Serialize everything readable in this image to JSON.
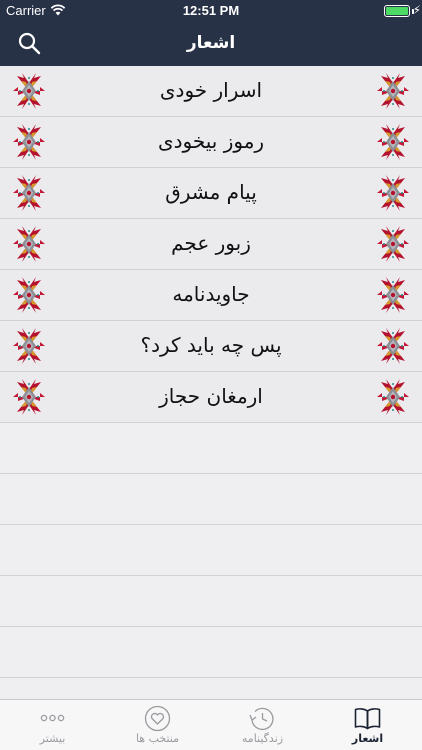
{
  "status_bar": {
    "carrier": "Carrier",
    "time": "12:51 PM",
    "battery_percent": 100
  },
  "header": {
    "title": "اشعار",
    "search_icon": "search-icon"
  },
  "colors": {
    "header_bg": "#283246",
    "row_bg": "#ebebee",
    "ornament_red": "#b5122f",
    "ornament_gold": "#d69a2c"
  },
  "poems": [
    {
      "label": "اسرار خودی"
    },
    {
      "label": "رموز بیخودی"
    },
    {
      "label": "پیام مشرق"
    },
    {
      "label": "زبور عجم"
    },
    {
      "label": "جاویدنامه"
    },
    {
      "label": "پس چه باید کرد؟"
    },
    {
      "label": "ارمغان حجاز"
    }
  ],
  "tabs": [
    {
      "label": "بیشتر",
      "icon": "more-dots-icon",
      "active": false
    },
    {
      "label": "منتخب ها",
      "icon": "heart-icon",
      "active": false
    },
    {
      "label": "زندگینامه",
      "icon": "history-icon",
      "active": false
    },
    {
      "label": "اشعار",
      "icon": "book-icon",
      "active": true
    }
  ]
}
